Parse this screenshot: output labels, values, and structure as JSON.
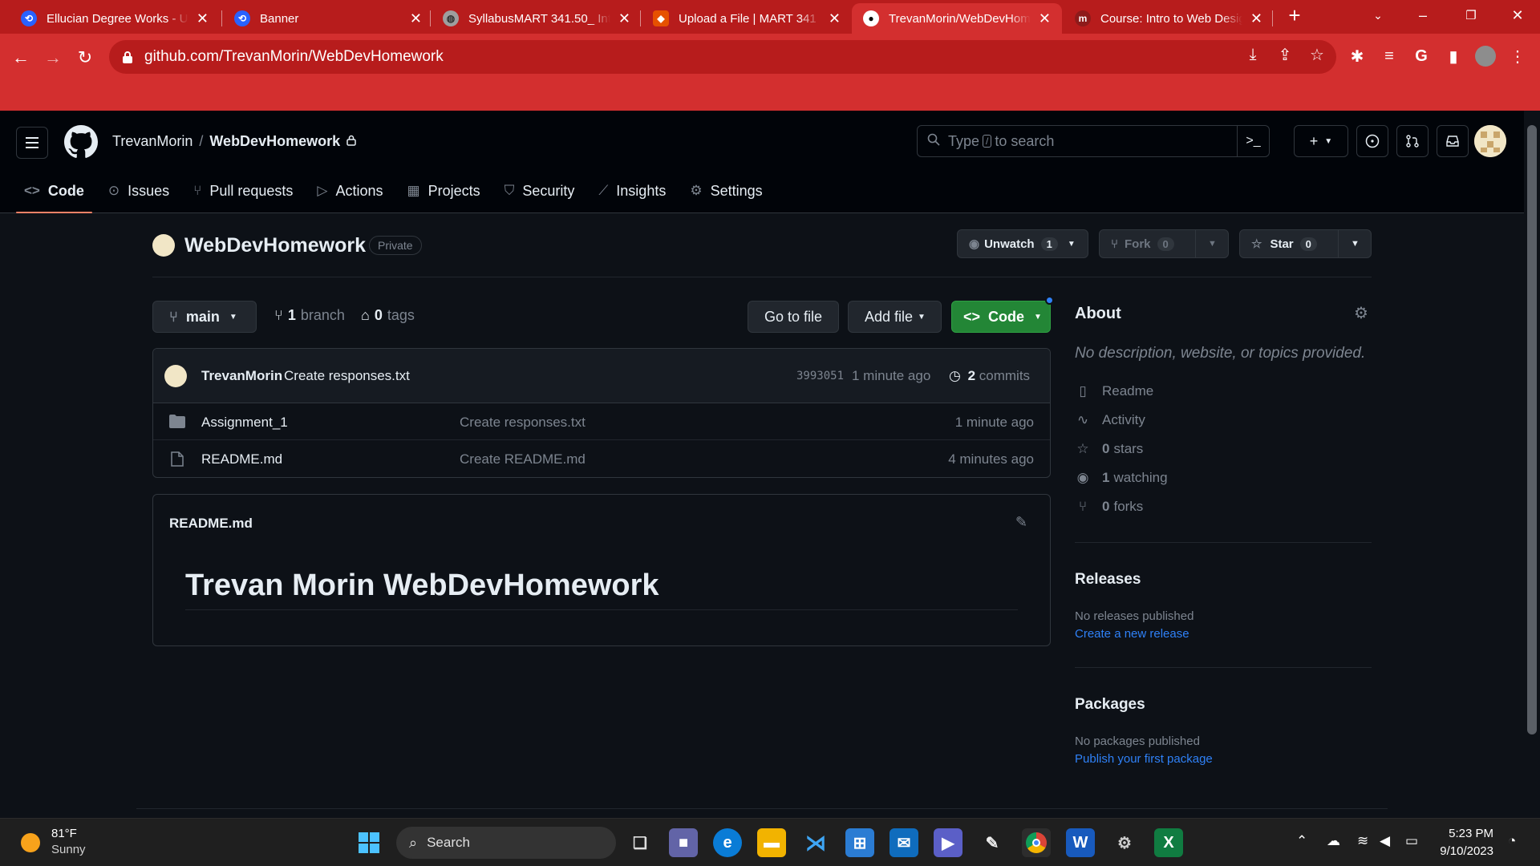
{
  "browser": {
    "tabs": [
      {
        "title": "Ellucian Degree Works - Un",
        "favicon": "ellucian-icon",
        "active": false
      },
      {
        "title": "Banner",
        "favicon": "ellucian-icon",
        "active": false
      },
      {
        "title": "SyllabusMART 341.50_ Intro",
        "favicon": "globe-icon",
        "active": false
      },
      {
        "title": "Upload a File | MART 341 In",
        "favicon": "canvas-icon",
        "active": false
      },
      {
        "title": "TrevanMorin/WebDevHome",
        "favicon": "github-icon",
        "active": true
      },
      {
        "title": "Course: Intro to Web Desig",
        "favicon": "moodle-icon",
        "active": false
      }
    ],
    "url": "github.com/TrevanMorin/WebDevHomework",
    "colors": {
      "chrome": "#d32f2f",
      "tabstrip": "#b71c1c"
    }
  },
  "github": {
    "header": {
      "owner": "TrevanMorin",
      "separator": "/",
      "repo": "WebDevHomework",
      "search_prefix": "Type",
      "search_key": "/",
      "search_suffix": "to search"
    },
    "nav": [
      {
        "label": "Code",
        "icon": "code-icon",
        "active": true
      },
      {
        "label": "Issues",
        "icon": "issue-icon"
      },
      {
        "label": "Pull requests",
        "icon": "pull-request-icon"
      },
      {
        "label": "Actions",
        "icon": "play-icon"
      },
      {
        "label": "Projects",
        "icon": "table-icon"
      },
      {
        "label": "Security",
        "icon": "shield-icon"
      },
      {
        "label": "Insights",
        "icon": "graph-icon"
      },
      {
        "label": "Settings",
        "icon": "gear-icon"
      }
    ],
    "repo_head": {
      "name": "WebDevHomework",
      "visibility": "Private",
      "unwatch_label": "Unwatch",
      "unwatch_count": "1",
      "fork_label": "Fork",
      "fork_count": "0",
      "star_label": "Star",
      "star_count": "0"
    },
    "branch_bar": {
      "branch": "main",
      "branch_count": "1",
      "branch_word": "branch",
      "tag_count": "0",
      "tag_word": "tags",
      "go_to_file": "Go to file",
      "add_file": "Add file",
      "code": "Code"
    },
    "latest_commit": {
      "author": "TrevanMorin",
      "message": "Create responses.txt",
      "sha": "3993051",
      "time": "1 minute ago",
      "count": "2",
      "count_word": "commits"
    },
    "files": [
      {
        "name": "Assignment_1",
        "type": "folder",
        "message": "Create responses.txt",
        "time": "1 minute ago"
      },
      {
        "name": "README.md",
        "type": "file",
        "message": "Create README.md",
        "time": "4 minutes ago"
      }
    ],
    "readme": {
      "title": "README.md",
      "heading": "Trevan Morin WebDevHomework"
    },
    "about": {
      "title": "About",
      "description": "No description, website, or topics provided.",
      "items": [
        {
          "icon": "book-icon",
          "count": "",
          "label": "Readme"
        },
        {
          "icon": "pulse-icon",
          "count": "",
          "label": "Activity"
        },
        {
          "icon": "star-icon",
          "count": "0",
          "label": "stars"
        },
        {
          "icon": "eye-icon",
          "count": "1",
          "label": "watching"
        },
        {
          "icon": "fork-icon",
          "count": "0",
          "label": "forks"
        }
      ]
    },
    "releases": {
      "title": "Releases",
      "empty": "No releases published",
      "link": "Create a new release"
    },
    "packages": {
      "title": "Packages",
      "empty": "No packages published",
      "link": "Publish your first package"
    },
    "colors": {
      "bg": "#0d1117",
      "header": "#010409",
      "accent": "#f78166",
      "green": "#238636",
      "link": "#2f81f7"
    }
  },
  "taskbar": {
    "weather_temp": "81°F",
    "weather_cond": "Sunny",
    "search": "Search",
    "time": "5:23 PM",
    "date": "9/10/2023"
  }
}
